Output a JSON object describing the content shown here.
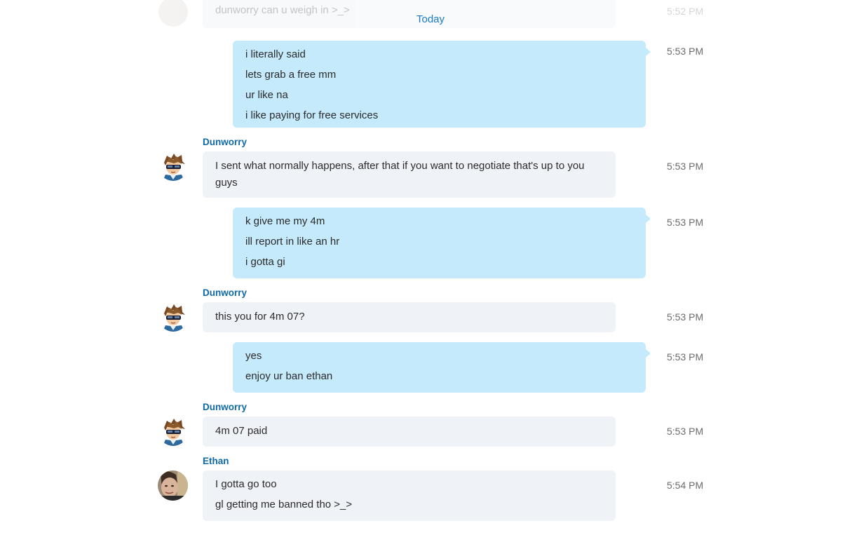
{
  "divider": {
    "label": "Today"
  },
  "faded": {
    "text": "dunworry can u weigh in >_>",
    "time": "5:52 PM"
  },
  "messages": [
    {
      "lines": [
        "i literally said",
        "lets grab a free mm",
        "ur like na",
        "i like paying for free services"
      ],
      "time": "5:53 PM"
    },
    {
      "sender": "Dunworry",
      "lines": [
        "I sent what normally happens, after that if you want to negotiate that's up to you guys"
      ],
      "time": "5:53 PM"
    },
    {
      "lines": [
        "k give me my 4m",
        "ill report in like an hr",
        "i gotta gi"
      ],
      "time": "5:53 PM"
    },
    {
      "sender": "Dunworry",
      "lines": [
        "this you for 4m 07?"
      ],
      "time": "5:53 PM"
    },
    {
      "lines": [
        "yes",
        "enjoy ur ban ethan"
      ],
      "time": "5:53 PM"
    },
    {
      "sender": "Dunworry",
      "lines": [
        "4m 07 paid"
      ],
      "time": "5:53 PM"
    },
    {
      "sender": "Ethan",
      "lines": [
        "I gotta go too",
        "gl getting me banned tho >_>"
      ],
      "time": "5:54 PM"
    }
  ],
  "avatars": {
    "dunworry": "anime-character-avatar",
    "ethan": "photo-avatar"
  }
}
